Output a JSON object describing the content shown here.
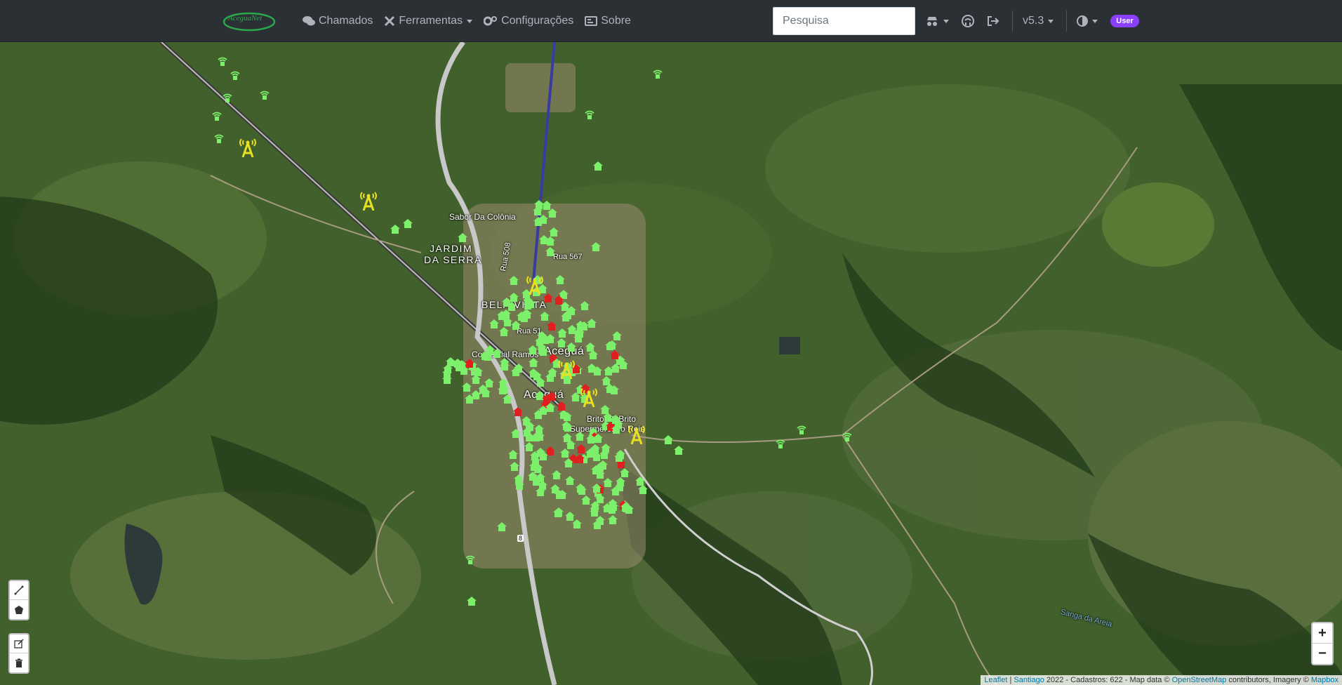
{
  "navbar": {
    "brand": "AceguaNet",
    "links": [
      {
        "label": "Chamados",
        "icon": "comments-icon",
        "dropdown": false
      },
      {
        "label": "Ferramentas",
        "icon": "tools-icon",
        "dropdown": true
      },
      {
        "label": "Configurações",
        "icon": "gears-icon",
        "dropdown": false
      },
      {
        "label": "Sobre",
        "icon": "id-card-icon",
        "dropdown": false
      }
    ],
    "search_placeholder": "Pesquisa",
    "version": "v5.3",
    "user_badge": "User"
  },
  "map": {
    "labels": {
      "sabor": "Sabor Da Colônia",
      "jardim1": "JARDIM",
      "jardim2": "DA SERRA",
      "bela": "BELA VISTA",
      "rua567": "Rua 567",
      "rua508": "Rua 508",
      "rua51": "Rua 51",
      "comercial": "Comercial Ramos",
      "acegua1": "Aceguá",
      "acegua2": "Aceguá",
      "britos": "Britos & Brito",
      "super": "Supermercado Reis",
      "route": "8",
      "sanga": "Sanga da Areia"
    },
    "zoom_in": "+",
    "zoom_out": "−",
    "attribution": {
      "leaflet": "Leaflet",
      "sep": " | ",
      "santiago": "Santiago",
      "text": " 2022 - Cadastros: 622 - Map data © ",
      "osm": "OpenStreetMap",
      "text2": " contributors, Imagery © ",
      "mapbox": "Mapbox"
    }
  }
}
